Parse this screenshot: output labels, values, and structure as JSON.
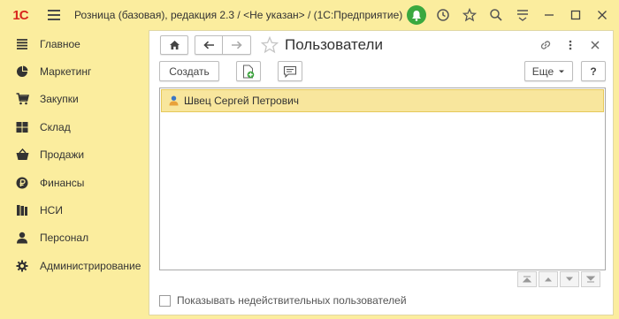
{
  "titlebar": {
    "logo_text": "1С",
    "title": "Розница (базовая), редакция 2.3 / <Не указан> /  (1С:Предприятие)"
  },
  "sidebar": {
    "items": [
      {
        "label": "Главное",
        "icon": "menu-lines-icon"
      },
      {
        "label": "Маркетинг",
        "icon": "pie-chart-icon"
      },
      {
        "label": "Закупки",
        "icon": "cart-icon"
      },
      {
        "label": "Склад",
        "icon": "warehouse-grid-icon"
      },
      {
        "label": "Продажи",
        "icon": "basket-icon"
      },
      {
        "label": "Финансы",
        "icon": "ruble-coin-icon"
      },
      {
        "label": "НСИ",
        "icon": "books-icon"
      },
      {
        "label": "Персонал",
        "icon": "person-icon"
      },
      {
        "label": "Администрирование",
        "icon": "gear-icon"
      }
    ]
  },
  "form": {
    "title": "Пользователи",
    "create_label": "Создать",
    "more_label": "Еще",
    "help_label": "?"
  },
  "list": {
    "rows": [
      {
        "name": "Швец Сергей Петрович",
        "selected": true
      }
    ]
  },
  "show_inactive_label": "Показывать недействительных пользователей",
  "colors": {
    "chrome_bg": "#fbed9e",
    "selected_row": "#f8e69d",
    "notification_green": "#3aa83f",
    "logo_red": "#d8261d"
  }
}
